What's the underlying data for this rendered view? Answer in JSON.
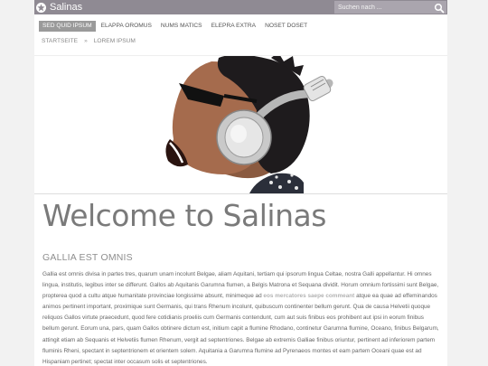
{
  "header": {
    "brand": "Salinas",
    "search_placeholder": "Suchen nach ..."
  },
  "nav": {
    "items": [
      {
        "label": "SED QUID IPSUM",
        "active": true
      },
      {
        "label": "ELAPPA OROMUS",
        "active": false
      },
      {
        "label": "NUMS MATICS",
        "active": false
      },
      {
        "label": "ELEPRA EXTRA",
        "active": false
      },
      {
        "label": "NOSET DOSET",
        "active": false
      }
    ]
  },
  "breadcrumb": {
    "home": "STARTSEITE",
    "separator": "»",
    "current": "LOREM IPSUM"
  },
  "content": {
    "title": "Welcome to Salinas",
    "subtitle": "GALLIA EST OMNIS",
    "body_before": "Gallia est omnis divisa in partes tres, quarum unam incolunt Belgae, aliam Aquitani, tertiam qui ipsorum lingua Celtae, nostra Galli appellantur. Hi omnes lingua, institutis, legibus inter se differunt. Gallos ab Aquitanis Garumna flumen, a Belgis Matrona et Sequana dividit. Horum omnium fortissimi sunt Belgae, propterea quod a cultu atque humanitate provinciae longissime absunt, minimeque ad ",
    "body_highlight": "eos mercatores saepe commeant",
    "body_after": " atque ea quae ad effeminandos animos pertinent important, proximique sunt Germanis, qui trans Rhenum incolunt, quibuscum continenter bellum gerunt. Qua de causa Helvetii quoque reliquos Gallos virtute praecedunt, quod fere cotidianis proeliis cum Germanis contendunt, cum aut suis finibus eos prohibent aut ipsi in eorum finibus bellum gerunt. Eorum una, pars, quam Gallos obtinere dictum est, initium capit a flumine Rhodano, continetur Garumna flumine, Oceano, finibus Belgarum, attingit etiam ab Sequanis et Helvetiis flumen Rhenum, vergit ad septentriones. Belgae ab extremis Galliae finibus oriuntur, pertinent ad inferiorem partem fluminis Rheni, spectant in septentrionem et orientem solem. Aquitania a Garumna flumine ad Pyrenaeos montes et eam partem Oceani quae est ad Hispaniam pertinet; spectat inter occasum solis et septentriones."
  },
  "icons": {
    "brand": "star-logo-icon",
    "search": "search-icon"
  },
  "colors": {
    "topbar": "#8f8a93",
    "nav_active": "#9a9a9a"
  }
}
